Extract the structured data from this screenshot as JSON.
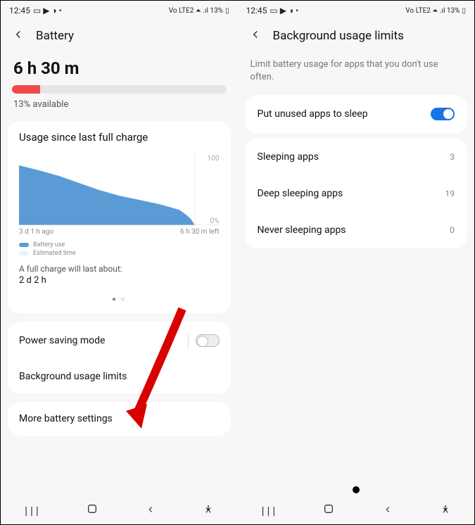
{
  "colors": {
    "accent_red": "#f04a4a",
    "accent_blue": "#1a73e8",
    "chart_blue": "#5b9bd5"
  },
  "status": {
    "time": "12:45",
    "icons": "▭ ▶ ◑ •",
    "right": "Vo LTE2 ⏶ .ıl 13%"
  },
  "left": {
    "header_title": "Battery",
    "big_time": "6 h 30 m",
    "available_pct": 13,
    "available_text": "13% available",
    "usage_title": "Usage since last full charge",
    "chart_y_top": "100",
    "chart_y_bot": "0%",
    "chart_x_left": "3 d 1 h ago",
    "chart_x_right": "6 h 30 m left",
    "legend_use": "Battery use",
    "legend_est": "Estimated time",
    "full_charge_label": "A full charge will last about:",
    "full_charge_value": "2 d 2 h",
    "page_dots": "● ○",
    "power_saving": "Power saving mode",
    "bg_limits": "Background usage limits",
    "more_settings": "More battery settings"
  },
  "right": {
    "header_title": "Background usage limits",
    "subtitle": "Limit battery usage for apps that you don't use often.",
    "put_sleep": "Put unused apps to sleep",
    "rows": [
      {
        "label": "Sleeping apps",
        "count": "3"
      },
      {
        "label": "Deep sleeping apps",
        "count": "19"
      },
      {
        "label": "Never sleeping apps",
        "count": "0"
      }
    ]
  },
  "chart_data": {
    "type": "area",
    "title": "Usage since last full charge",
    "xlabel": "",
    "ylabel": "",
    "x_range_label_left": "3 d 1 h ago",
    "x_range_label_right": "6 h 30 m left",
    "ylim": [
      0,
      100
    ],
    "series": [
      {
        "name": "Battery use",
        "color": "#5b9bd5",
        "x": [
          0,
          10,
          20,
          30,
          40,
          50,
          60,
          70,
          80,
          84,
          86,
          88
        ],
        "values": [
          85,
          78,
          70,
          60,
          50,
          42,
          36,
          30,
          22,
          14,
          8,
          0
        ]
      },
      {
        "name": "Estimated time",
        "color": "#e9f2fb",
        "x": [
          88,
          100
        ],
        "values": [
          0,
          0
        ]
      }
    ]
  }
}
